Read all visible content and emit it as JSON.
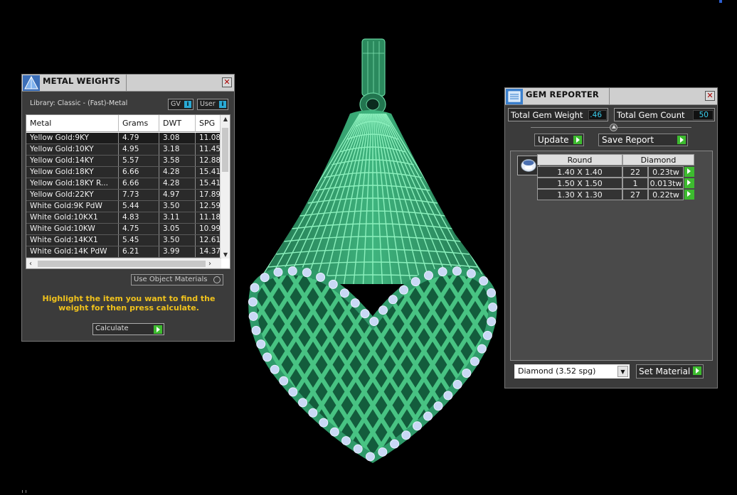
{
  "metal_weights": {
    "title": "METAL WEIGHTS",
    "library_label": "Library: Classic - (Fast)-Metal",
    "gv_label": "GV",
    "user_label": "User",
    "columns": [
      "Metal",
      "Grams",
      "DWT",
      "SPG"
    ],
    "rows": [
      {
        "metal": "Yellow Gold:9KY",
        "grams": "4.79",
        "dwt": "3.08",
        "spg": "11.08"
      },
      {
        "metal": "Yellow Gold:10KY",
        "grams": "4.95",
        "dwt": "3.18",
        "spg": "11.45"
      },
      {
        "metal": "Yellow Gold:14KY",
        "grams": "5.57",
        "dwt": "3.58",
        "spg": "12.88"
      },
      {
        "metal": "Yellow Gold:18KY",
        "grams": "6.66",
        "dwt": "4.28",
        "spg": "15.41"
      },
      {
        "metal": "Yellow Gold:18KY R...",
        "grams": "6.66",
        "dwt": "4.28",
        "spg": "15.41"
      },
      {
        "metal": "Yellow Gold:22KY",
        "grams": "7.73",
        "dwt": "4.97",
        "spg": "17.89"
      },
      {
        "metal": "White Gold:9K PdW",
        "grams": "5.44",
        "dwt": "3.50",
        "spg": "12.59"
      },
      {
        "metal": "White Gold:10KX1",
        "grams": "4.83",
        "dwt": "3.11",
        "spg": "11.18"
      },
      {
        "metal": "White Gold:10KW",
        "grams": "4.75",
        "dwt": "3.05",
        "spg": "10.99"
      },
      {
        "metal": "White Gold:14KX1",
        "grams": "5.45",
        "dwt": "3.50",
        "spg": "12.61"
      },
      {
        "metal": "White Gold:14K PdW",
        "grams": "6.21",
        "dwt": "3.99",
        "spg": "14.37"
      }
    ],
    "use_object_materials_label": "Use Object Materials",
    "hint": "Highlight the item you want to find the weight for then press calculate.",
    "calculate_label": "Calculate",
    "close_glyph": "✕"
  },
  "gem_reporter": {
    "title": "GEM REPORTER",
    "total_weight_label": "Total Gem Weight",
    "total_weight_value": ".46",
    "total_count_label": "Total Gem Count",
    "total_count_value": "50",
    "update_label": "Update",
    "save_report_label": "Save Report",
    "headers": [
      "Round",
      "Diamond"
    ],
    "gems": [
      {
        "size": "1.40 X 1.40",
        "count": "22",
        "weight": "0.23tw"
      },
      {
        "size": "1.50 X 1.50",
        "count": "1",
        "weight": "0.013tw"
      },
      {
        "size": "1.30 X 1.30",
        "count": "27",
        "weight": "0.22tw"
      }
    ],
    "material_select": "Diamond    (3.52 spg)",
    "set_material_label": "Set Material",
    "close_glyph": "✕"
  },
  "colors": {
    "background": "#000000",
    "model_green": "#2f9a6a",
    "accent_green": "#3dbb2f",
    "hint_yellow": "#f0c21c",
    "value_cyan": "#3ad0f0",
    "gem_blue": "#c9d8f5"
  },
  "icons": {
    "metal_title": "pyramid-icon",
    "gem_title": "report-icon",
    "gem_shape": "round-gem-icon"
  }
}
